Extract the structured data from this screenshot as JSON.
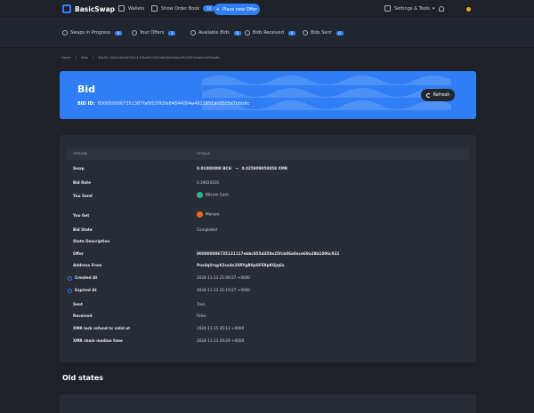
{
  "app": {
    "name": "BasicSwap"
  },
  "topnav": {
    "wallets": "Wallets",
    "order_book": "Show Order Book",
    "order_book_count": "10",
    "new_offer": "Place new Offer",
    "settings": "Settings & Tools"
  },
  "subnav": {
    "items": [
      {
        "label": "Swaps in Progress",
        "count": "0"
      },
      {
        "label": "Your Offers",
        "count": "1"
      },
      {
        "label": "Available Bids",
        "count": "0"
      },
      {
        "label": "Bids Received",
        "count": "0"
      },
      {
        "label": "Bids Sent",
        "count": "0"
      }
    ]
  },
  "breadcrumb": {
    "home": "Home",
    "sep": "/",
    "bids": "Bids",
    "current": "Bid ID: 00000000673513 87faf952f92fe84844004a4922851acd2c5d7bbb6c"
  },
  "hero": {
    "title": "Bid",
    "bid_id_label": "BID ID:",
    "bid_id": "0000000067351387faf952f92fe84844004a4922851acd2c5d7bbb6c",
    "refresh": "Refresh"
  },
  "table": {
    "col_options": "Options",
    "col_details": "Details",
    "rows": {
      "swap": {
        "label": "Swap",
        "from": "0.01000000 BCH",
        "to": "0.025909050858 XMR"
      },
      "bid_rate": {
        "label": "Bid Rate",
        "value": "0.34024101"
      },
      "you_send": {
        "label": "You Send",
        "value": "Bitcoin Cash"
      },
      "you_get": {
        "label": "You Get",
        "value": "Monero"
      },
      "bid_state": {
        "label": "Bid State",
        "value": "Completed"
      },
      "state_desc": {
        "label": "State Description",
        "value": ""
      },
      "offer": {
        "label": "Offer",
        "value": "000000006735131117ebbc855d350e25fcb06a0ace69a28b1006c922"
      },
      "address_from": {
        "label": "Address From",
        "value": "Pos4qUrqy82sx4n2SRYgB0pGFE8pKGJq6x"
      },
      "created_at": {
        "label": "Created At",
        "value": "2024-11-13 21:09:27 +0000"
      },
      "expired_at": {
        "label": "Expired At",
        "value": "2024-11-13 21:19:27 +0000"
      },
      "sent": {
        "label": "Sent",
        "value": "True"
      },
      "received": {
        "label": "Received",
        "value": "False"
      },
      "xmr_lock": {
        "label": "XMR lock refund tx valid at",
        "value": "2024-11-15 05:13 +0000"
      },
      "xmr_chain": {
        "label": "XMR chain median time",
        "value": "2024-11-13 20:29 +0000"
      }
    }
  },
  "old_states": {
    "title": "Old states"
  }
}
